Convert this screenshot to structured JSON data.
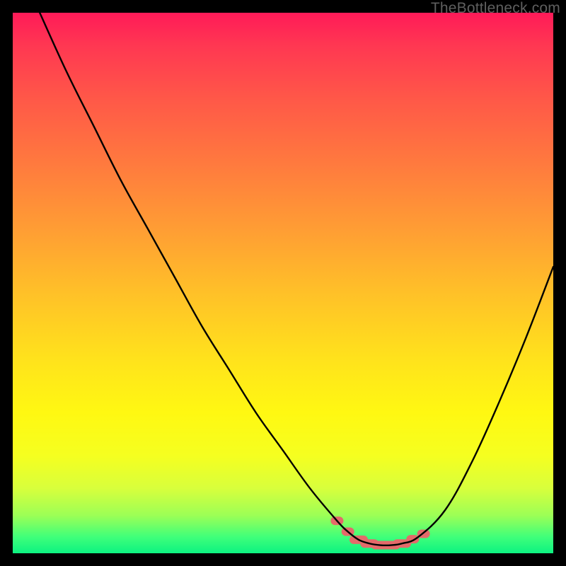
{
  "watermark": "TheBottleneck.com",
  "colors": {
    "stroke": "#000000",
    "marker": "#e46a6a",
    "background": "#000000"
  },
  "chart_data": {
    "type": "line",
    "title": "",
    "xlabel": "",
    "ylabel": "",
    "xlim": [
      0,
      100
    ],
    "ylim": [
      0,
      100
    ],
    "series": [
      {
        "name": "bottleneck-curve",
        "x": [
          5,
          10,
          15,
          20,
          25,
          30,
          35,
          40,
          45,
          50,
          55,
          60,
          62,
          64,
          66,
          68,
          70,
          72,
          75,
          80,
          85,
          90,
          95,
          100
        ],
        "y": [
          100,
          89,
          79,
          69,
          60,
          51,
          42,
          34,
          26,
          19,
          12,
          6,
          4,
          2.5,
          1.8,
          1.5,
          1.5,
          1.8,
          3,
          8,
          17,
          28,
          40,
          53
        ]
      }
    ],
    "markers": {
      "name": "highlight-band",
      "x": [
        60,
        62,
        64,
        66,
        68,
        70,
        72,
        74,
        76
      ],
      "y": [
        6,
        4,
        2.5,
        1.8,
        1.5,
        1.5,
        1.8,
        2.6,
        3.6
      ]
    }
  }
}
